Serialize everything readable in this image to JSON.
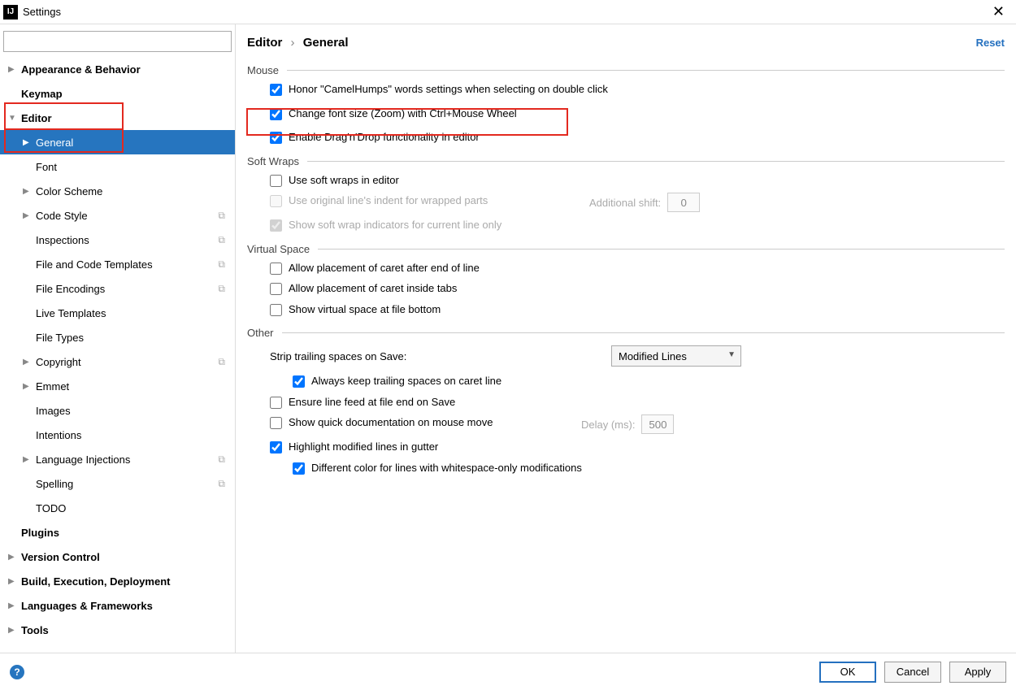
{
  "window": {
    "title": "Settings"
  },
  "actions": {
    "reset": "Reset",
    "ok": "OK",
    "cancel": "Cancel",
    "apply": "Apply"
  },
  "breadcrumb": {
    "a": "Editor",
    "b": "General"
  },
  "sidebar": {
    "search_placeholder": "",
    "items": [
      {
        "label": "Appearance & Behavior",
        "bold": true,
        "chev": "right"
      },
      {
        "label": "Keymap",
        "bold": true
      },
      {
        "label": "Editor",
        "bold": true,
        "chev": "down"
      },
      {
        "label": "General",
        "level": 1,
        "chev": "right",
        "selected": true
      },
      {
        "label": "Font",
        "level": 1
      },
      {
        "label": "Color Scheme",
        "level": 1,
        "chev": "right"
      },
      {
        "label": "Code Style",
        "level": 1,
        "chev": "right",
        "copy": true
      },
      {
        "label": "Inspections",
        "level": 1,
        "copy": true
      },
      {
        "label": "File and Code Templates",
        "level": 1,
        "copy": true
      },
      {
        "label": "File Encodings",
        "level": 1,
        "copy": true
      },
      {
        "label": "Live Templates",
        "level": 1
      },
      {
        "label": "File Types",
        "level": 1
      },
      {
        "label": "Copyright",
        "level": 1,
        "chev": "right",
        "copy": true
      },
      {
        "label": "Emmet",
        "level": 1,
        "chev": "right"
      },
      {
        "label": "Images",
        "level": 1
      },
      {
        "label": "Intentions",
        "level": 1
      },
      {
        "label": "Language Injections",
        "level": 1,
        "chev": "right",
        "copy": true
      },
      {
        "label": "Spelling",
        "level": 1,
        "copy": true
      },
      {
        "label": "TODO",
        "level": 1
      },
      {
        "label": "Plugins",
        "bold": true
      },
      {
        "label": "Version Control",
        "bold": true,
        "chev": "right"
      },
      {
        "label": "Build, Execution, Deployment",
        "bold": true,
        "chev": "right"
      },
      {
        "label": "Languages & Frameworks",
        "bold": true,
        "chev": "right"
      },
      {
        "label": "Tools",
        "bold": true,
        "chev": "right"
      }
    ]
  },
  "sections": {
    "mouse": {
      "title": "Mouse",
      "honor": "Honor \"CamelHumps\" words settings when selecting on double click",
      "zoom": "Change font size (Zoom) with Ctrl+Mouse Wheel",
      "dnd": "Enable Drag'n'Drop functionality in editor"
    },
    "softwraps": {
      "title": "Soft Wraps",
      "use": "Use soft wraps in editor",
      "orig": "Use original line's indent for wrapped parts",
      "addshift_label": "Additional shift:",
      "addshift_value": "0",
      "indicators": "Show soft wrap indicators for current line only"
    },
    "virtual": {
      "title": "Virtual Space",
      "caret_eol": "Allow placement of caret after end of line",
      "caret_tabs": "Allow placement of caret inside tabs",
      "show_bottom": "Show virtual space at file bottom"
    },
    "other": {
      "title": "Other",
      "strip_label": "Strip trailing spaces on Save:",
      "strip_value": "Modified Lines",
      "always_keep": "Always keep trailing spaces on caret line",
      "ensure_lf": "Ensure line feed at file end on Save",
      "quick_doc": "Show quick documentation on mouse move",
      "delay_label": "Delay (ms):",
      "delay_value": "500",
      "highlight_gutter": "Highlight modified lines in gutter",
      "diff_color": "Different color for lines with whitespace-only modifications"
    }
  }
}
